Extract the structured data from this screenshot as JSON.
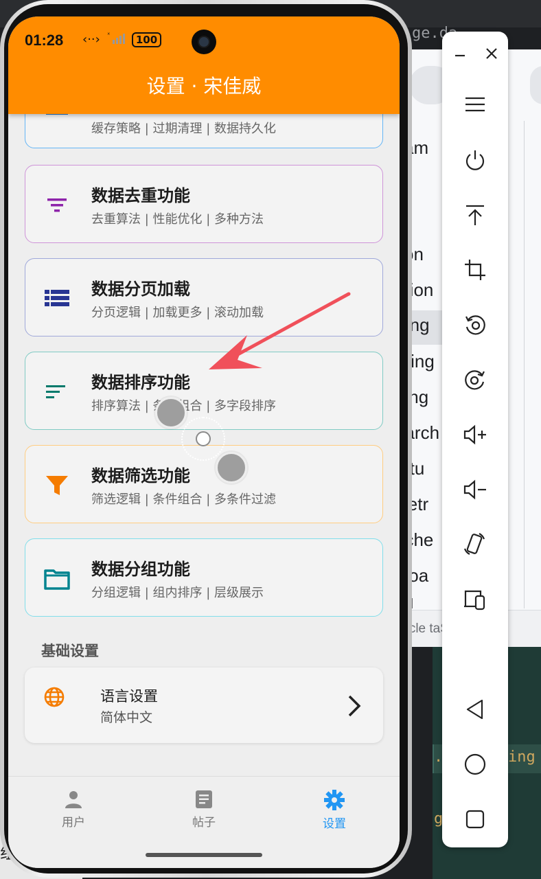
{
  "phone": {
    "status_time": "01:28",
    "status_network": "‹··›",
    "status_signal": "ˣ",
    "battery": "100",
    "title": "设置 · 宋佳威"
  },
  "cards": [
    {
      "title": "",
      "subtitle": "缓存策略 | 过期清理 | 数据持久化",
      "border": "#64b5f6",
      "icon": "storage-icon",
      "icon_color": "#1976d2"
    },
    {
      "title": "数据去重功能",
      "subtitle": "去重算法 | 性能优化 | 多种方法",
      "border": "#ce93d8",
      "icon": "filter-list-icon",
      "icon_color": "#8e24aa"
    },
    {
      "title": "数据分页加载",
      "subtitle": "分页逻辑 | 加载更多 | 滚动加载",
      "border": "#9fa8da",
      "icon": "view-list-icon",
      "icon_color": "#283593"
    },
    {
      "title": "数据排序功能",
      "subtitle": "排序算法 | 条件组合 | 多字段排序",
      "border": "#80cbc4",
      "icon": "sort-icon",
      "icon_color": "#00796b"
    },
    {
      "title": "数据筛选功能",
      "subtitle": "筛选逻辑 | 条件组合 | 多条件过滤",
      "border": "#ffcc80",
      "icon": "funnel-icon",
      "icon_color": "#f57c00"
    },
    {
      "title": "数据分组功能",
      "subtitle": "分组逻辑 | 组内排序 | 层级展示",
      "border": "#80deea",
      "icon": "folder-icon",
      "icon_color": "#00838f"
    }
  ],
  "basic_settings": {
    "section_title": "基础设置",
    "language_label": "语言设置",
    "language_value": "简体中文"
  },
  "bottom_nav": [
    {
      "label": "用户",
      "icon": "person-icon",
      "active": false
    },
    {
      "label": "帖子",
      "icon": "article-icon",
      "active": false
    },
    {
      "label": "设置",
      "icon": "gear-icon",
      "active": true
    }
  ],
  "colors": {
    "app_bar": "#ff8c00",
    "active_nav": "#2196f3",
    "annotation_arrow": "#f0505a"
  },
  "background": {
    "tab_text": "ge.da",
    "list_items": [
      "yam",
      "tion",
      "ation",
      "rting",
      "ering",
      "ping",
      "earch",
      "tatu",
      "Retr",
      "ache",
      "nloa",
      "ml"
    ],
    "bottom_tabs": "rticle        taSor",
    "code_1": ". ",
    "code_2": "ing",
    "code_3": "g",
    "left_strip": "组内排序"
  },
  "emulator_toolbar": [
    "minimize-icon",
    "close-icon",
    "menu-icon",
    "power-icon",
    "upload-icon",
    "crop-icon",
    "rotate-left-icon",
    "rotate-right-icon",
    "volume-up-icon",
    "volume-down-icon",
    "rotate-device-icon",
    "multi-device-icon",
    "back-icon",
    "home-icon",
    "overview-icon"
  ]
}
